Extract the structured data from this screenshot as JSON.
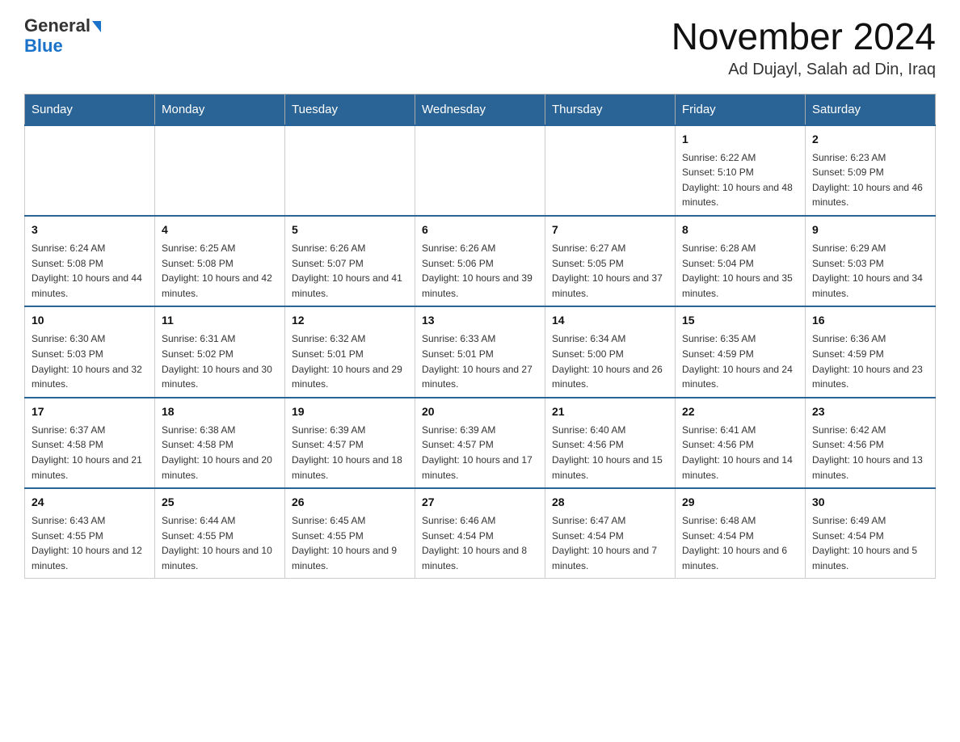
{
  "header": {
    "logo_line1": "General",
    "logo_line2": "Blue",
    "main_title": "November 2024",
    "subtitle": "Ad Dujayl, Salah ad Din, Iraq"
  },
  "calendar": {
    "days_of_week": [
      "Sunday",
      "Monday",
      "Tuesday",
      "Wednesday",
      "Thursday",
      "Friday",
      "Saturday"
    ],
    "weeks": [
      [
        {
          "day": "",
          "info": ""
        },
        {
          "day": "",
          "info": ""
        },
        {
          "day": "",
          "info": ""
        },
        {
          "day": "",
          "info": ""
        },
        {
          "day": "",
          "info": ""
        },
        {
          "day": "1",
          "info": "Sunrise: 6:22 AM\nSunset: 5:10 PM\nDaylight: 10 hours and 48 minutes."
        },
        {
          "day": "2",
          "info": "Sunrise: 6:23 AM\nSunset: 5:09 PM\nDaylight: 10 hours and 46 minutes."
        }
      ],
      [
        {
          "day": "3",
          "info": "Sunrise: 6:24 AM\nSunset: 5:08 PM\nDaylight: 10 hours and 44 minutes."
        },
        {
          "day": "4",
          "info": "Sunrise: 6:25 AM\nSunset: 5:08 PM\nDaylight: 10 hours and 42 minutes."
        },
        {
          "day": "5",
          "info": "Sunrise: 6:26 AM\nSunset: 5:07 PM\nDaylight: 10 hours and 41 minutes."
        },
        {
          "day": "6",
          "info": "Sunrise: 6:26 AM\nSunset: 5:06 PM\nDaylight: 10 hours and 39 minutes."
        },
        {
          "day": "7",
          "info": "Sunrise: 6:27 AM\nSunset: 5:05 PM\nDaylight: 10 hours and 37 minutes."
        },
        {
          "day": "8",
          "info": "Sunrise: 6:28 AM\nSunset: 5:04 PM\nDaylight: 10 hours and 35 minutes."
        },
        {
          "day": "9",
          "info": "Sunrise: 6:29 AM\nSunset: 5:03 PM\nDaylight: 10 hours and 34 minutes."
        }
      ],
      [
        {
          "day": "10",
          "info": "Sunrise: 6:30 AM\nSunset: 5:03 PM\nDaylight: 10 hours and 32 minutes."
        },
        {
          "day": "11",
          "info": "Sunrise: 6:31 AM\nSunset: 5:02 PM\nDaylight: 10 hours and 30 minutes."
        },
        {
          "day": "12",
          "info": "Sunrise: 6:32 AM\nSunset: 5:01 PM\nDaylight: 10 hours and 29 minutes."
        },
        {
          "day": "13",
          "info": "Sunrise: 6:33 AM\nSunset: 5:01 PM\nDaylight: 10 hours and 27 minutes."
        },
        {
          "day": "14",
          "info": "Sunrise: 6:34 AM\nSunset: 5:00 PM\nDaylight: 10 hours and 26 minutes."
        },
        {
          "day": "15",
          "info": "Sunrise: 6:35 AM\nSunset: 4:59 PM\nDaylight: 10 hours and 24 minutes."
        },
        {
          "day": "16",
          "info": "Sunrise: 6:36 AM\nSunset: 4:59 PM\nDaylight: 10 hours and 23 minutes."
        }
      ],
      [
        {
          "day": "17",
          "info": "Sunrise: 6:37 AM\nSunset: 4:58 PM\nDaylight: 10 hours and 21 minutes."
        },
        {
          "day": "18",
          "info": "Sunrise: 6:38 AM\nSunset: 4:58 PM\nDaylight: 10 hours and 20 minutes."
        },
        {
          "day": "19",
          "info": "Sunrise: 6:39 AM\nSunset: 4:57 PM\nDaylight: 10 hours and 18 minutes."
        },
        {
          "day": "20",
          "info": "Sunrise: 6:39 AM\nSunset: 4:57 PM\nDaylight: 10 hours and 17 minutes."
        },
        {
          "day": "21",
          "info": "Sunrise: 6:40 AM\nSunset: 4:56 PM\nDaylight: 10 hours and 15 minutes."
        },
        {
          "day": "22",
          "info": "Sunrise: 6:41 AM\nSunset: 4:56 PM\nDaylight: 10 hours and 14 minutes."
        },
        {
          "day": "23",
          "info": "Sunrise: 6:42 AM\nSunset: 4:56 PM\nDaylight: 10 hours and 13 minutes."
        }
      ],
      [
        {
          "day": "24",
          "info": "Sunrise: 6:43 AM\nSunset: 4:55 PM\nDaylight: 10 hours and 12 minutes."
        },
        {
          "day": "25",
          "info": "Sunrise: 6:44 AM\nSunset: 4:55 PM\nDaylight: 10 hours and 10 minutes."
        },
        {
          "day": "26",
          "info": "Sunrise: 6:45 AM\nSunset: 4:55 PM\nDaylight: 10 hours and 9 minutes."
        },
        {
          "day": "27",
          "info": "Sunrise: 6:46 AM\nSunset: 4:54 PM\nDaylight: 10 hours and 8 minutes."
        },
        {
          "day": "28",
          "info": "Sunrise: 6:47 AM\nSunset: 4:54 PM\nDaylight: 10 hours and 7 minutes."
        },
        {
          "day": "29",
          "info": "Sunrise: 6:48 AM\nSunset: 4:54 PM\nDaylight: 10 hours and 6 minutes."
        },
        {
          "day": "30",
          "info": "Sunrise: 6:49 AM\nSunset: 4:54 PM\nDaylight: 10 hours and 5 minutes."
        }
      ]
    ]
  }
}
